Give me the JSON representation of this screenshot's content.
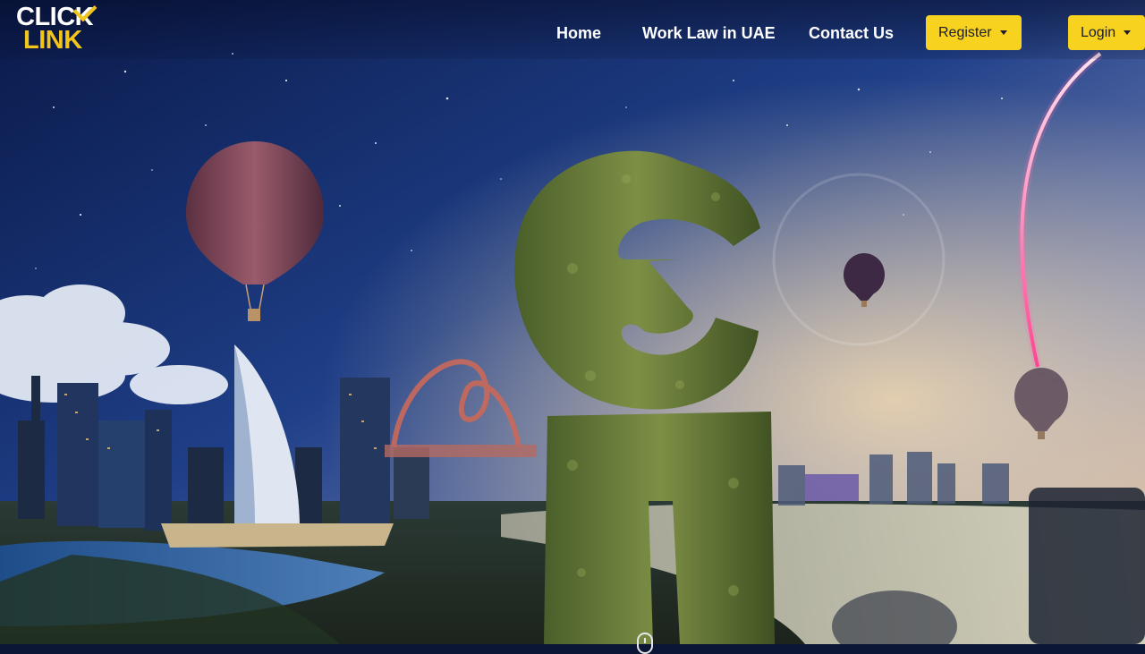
{
  "brand": {
    "logo_line1": "CLICK",
    "logo_line2": "LINK",
    "accent_color": "#f7d21e"
  },
  "nav": {
    "links": [
      {
        "label": "Home"
      },
      {
        "label": "Work Law in UAE"
      },
      {
        "label": "Contact Us"
      }
    ],
    "register_label": "Register",
    "login_label": "Login"
  },
  "hero": {
    "background": "night city skyline with hot air balloons and topiary CL letters"
  }
}
